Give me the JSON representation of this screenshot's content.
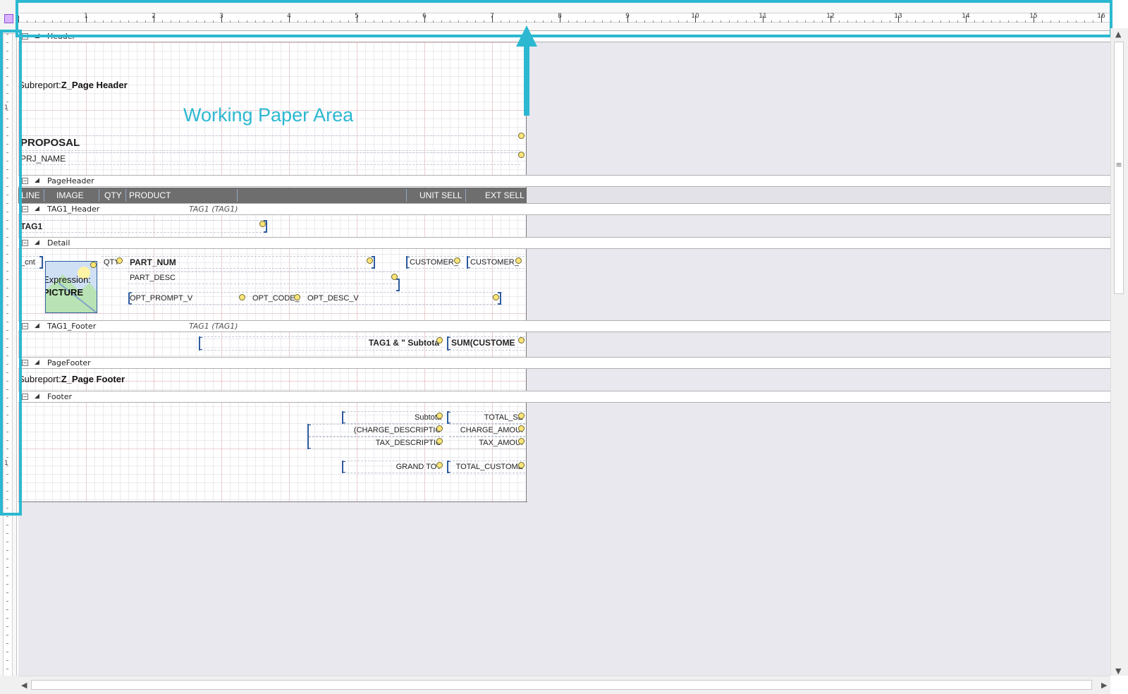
{
  "rulers": {
    "horizontal_numbers": [
      "1",
      "2",
      "3",
      "4",
      "5",
      "6",
      "7",
      "8",
      "9",
      "10",
      "11",
      "12",
      "13",
      "14",
      "15",
      "16"
    ],
    "vertical_numbers": [
      "1",
      "1"
    ]
  },
  "callout": {
    "label": "Working Paper Area"
  },
  "bands": {
    "header": "Header",
    "page_header": "PageHeader",
    "tag1_header": "TAG1_Header",
    "tag1_header_group": "TAG1 (TAG1)",
    "detail": "Detail",
    "tag1_footer": "TAG1_Footer",
    "tag1_footer_group": "TAG1 (TAG1)",
    "page_footer": "PageFooter",
    "footer": "Footer"
  },
  "header_band": {
    "subreport_prefix": "Subreport:",
    "subreport_name": "Z_Page Header",
    "title": "PROPOSAL",
    "project_field": "PRJ_NAME"
  },
  "column_headers": [
    "LINE",
    "IMAGE",
    "QTY",
    "PRODUCT",
    "UNIT SELL",
    "EXT SELL"
  ],
  "tag1_header_field": "TAG1",
  "detail_band": {
    "line_field": "_cnt",
    "picture_label": "Expression:",
    "picture_value": "PICTURE",
    "qty_field": "QTY",
    "part_num": "PART_NUM",
    "part_desc": "PART_DESC",
    "customer_1": "CUSTOMER_",
    "customer_2": "CUSTOMER_",
    "opt_prompt": "OPT_PROMPT_V",
    "opt_code": "OPT_CODE_",
    "opt_desc": "OPT_DESC_V"
  },
  "tag1_footer_band": {
    "subtotal_label": "TAG1 & \"  Subtota",
    "subtotal_value": "SUM(CUSTOME"
  },
  "page_footer_band": {
    "subreport_prefix": "Subreport:",
    "subreport_name": "Z_Page Footer"
  },
  "footer_band": {
    "subtotal_label": "Subtota",
    "subtotal_value": "TOTAL_SE",
    "charge_label": "(CHARGE_DESCRIPTIO",
    "charge_value": "CHARGE_AMOUI",
    "tax_label": "TAX_DESCRIPTIC",
    "tax_value": "TAX_AMOUI",
    "grand_label": "GRAND TOT",
    "grand_value": "TOTAL_CUSTOME"
  },
  "colors": {
    "accent": "#2cb8d0",
    "column_header_bg": "#6e6e6e",
    "canvas_bg": "#e9e8ee",
    "bracket": "#2d5b9e"
  }
}
